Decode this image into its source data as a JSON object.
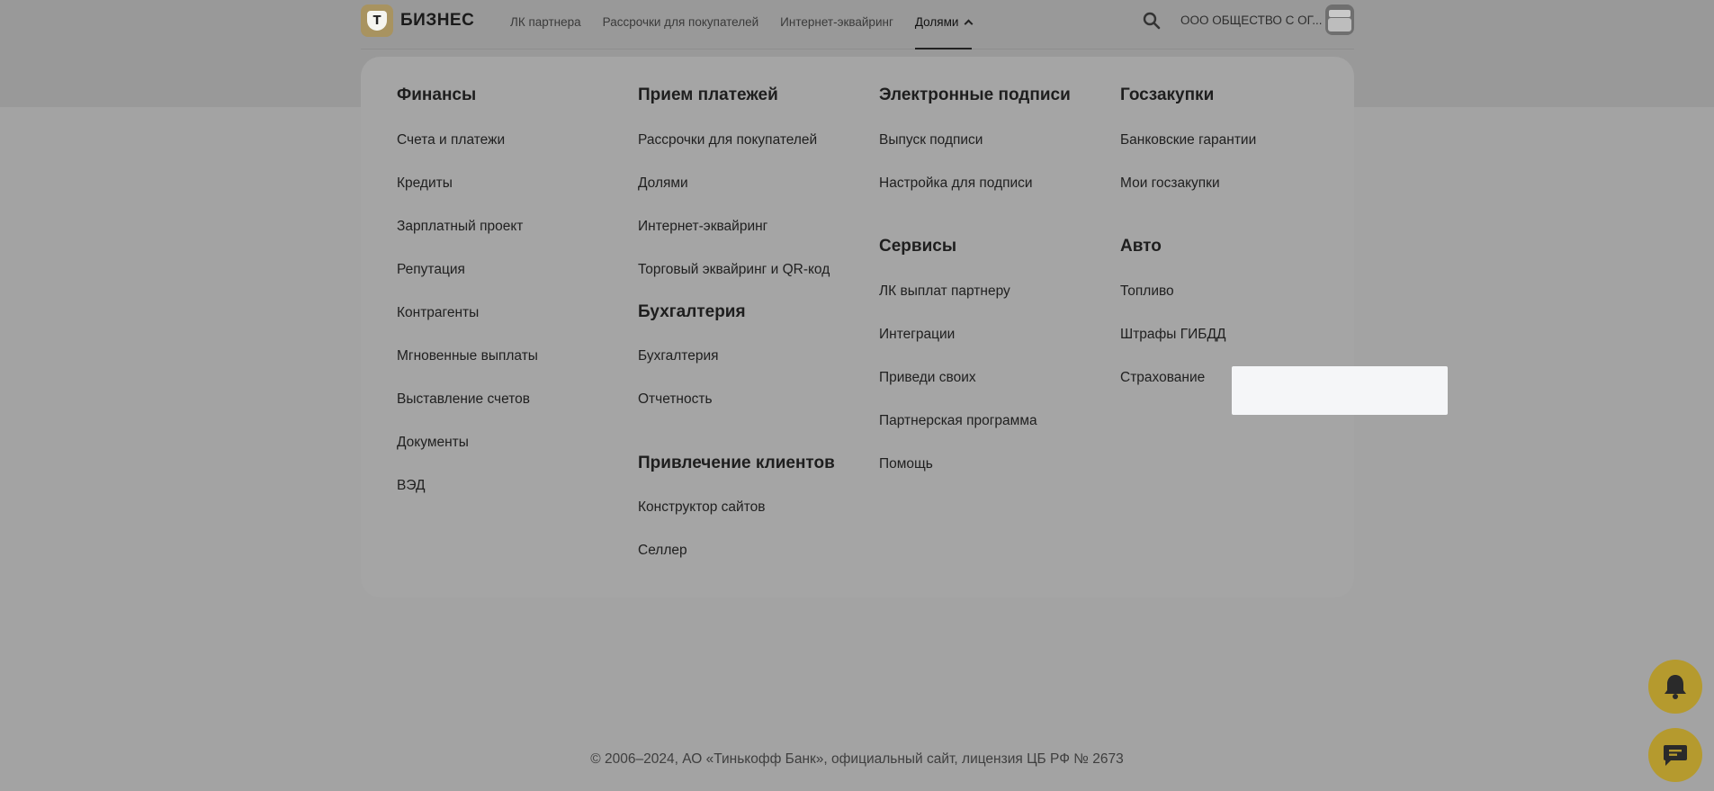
{
  "brand": {
    "logo_letter": "Т",
    "name": "БИЗНЕС"
  },
  "topnav": [
    {
      "label": "ЛК партнера"
    },
    {
      "label": "Рассрочки для покупателей"
    },
    {
      "label": "Интернет-эквайринг"
    },
    {
      "label": "Долями"
    }
  ],
  "header": {
    "company": "ООО ОБЩЕСТВО С ОГ..."
  },
  "menu": {
    "finance": {
      "heading": "Финансы",
      "items": [
        "Счета и платежи",
        "Кредиты",
        "Зарплатный проект",
        "Репутация",
        "Контрагенты",
        "Мгновенные выплаты",
        "Выставление счетов",
        "Документы",
        "ВЭД"
      ]
    },
    "payments": {
      "heading": "Прием платежей",
      "items": [
        "Рассрочки для покупателей",
        "Долями",
        "Интернет-эквайринг",
        "Торговый эквайринг и QR-код"
      ]
    },
    "accounting": {
      "heading": "Бухгалтерия",
      "items": [
        "Бухгалтерия",
        "Отчетность"
      ]
    },
    "clients": {
      "heading": "Привлечение клиентов",
      "items": [
        "Конструктор сайтов",
        "Селлер"
      ]
    },
    "signatures": {
      "heading": "Электронные подписи",
      "items": [
        "Выпуск подписи",
        "Настройка для подписи"
      ]
    },
    "services": {
      "heading": "Сервисы",
      "items": [
        "ЛК выплат партнеру",
        "Интеграции",
        "Приведи своих",
        "Партнерская программа",
        "Помощь"
      ]
    },
    "procurement": {
      "heading": "Госзакупки",
      "items": [
        "Банковские гарантии",
        "Мои госзакупки"
      ]
    },
    "auto": {
      "heading": "Авто",
      "items": [
        "Топливо",
        "Штрафы ГИБДД",
        "Страхование"
      ]
    }
  },
  "footer": {
    "text": "© 2006–2024, АО «Тинькофф Банк», официальный сайт, лицензия ЦБ РФ № 2673"
  },
  "icons": {
    "search": "search-icon",
    "notifications": "bell-icon",
    "chat": "chat-icon"
  },
  "colors": {
    "accent": "#ffdd2d",
    "highlight": "#f5f6f8"
  }
}
